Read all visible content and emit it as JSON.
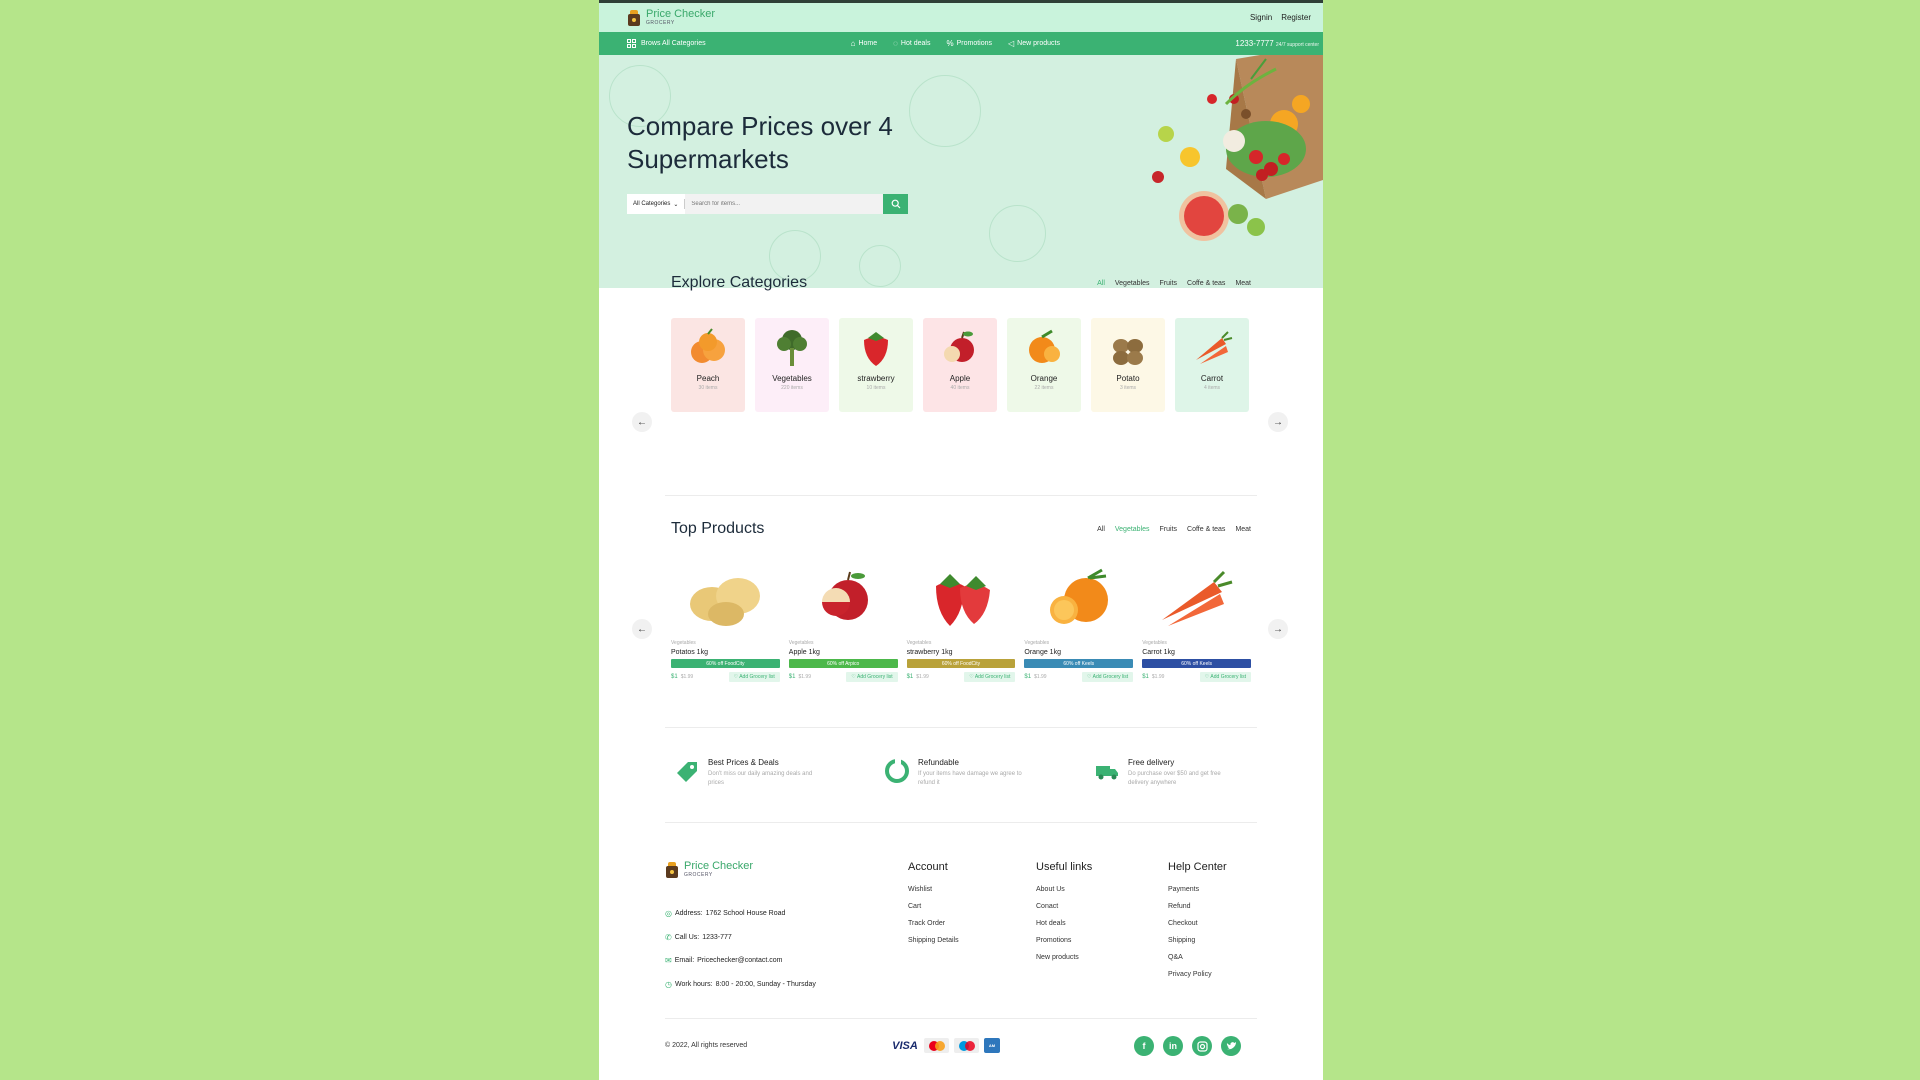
{
  "brand": {
    "name": "Price Checker",
    "sub": "GROCERY"
  },
  "auth": {
    "signin": "Signin",
    "register": "Register"
  },
  "nav": {
    "browse": "Brows All Categories",
    "links": [
      {
        "label": "Home",
        "icon": "home-icon"
      },
      {
        "label": "Hot deals",
        "icon": "flame-icon"
      },
      {
        "label": "Promotions",
        "icon": "percent-icon"
      },
      {
        "label": "New products",
        "icon": "megaphone-icon"
      }
    ],
    "phone": "1233-7777",
    "support": "24/7 support center"
  },
  "hero": {
    "title": "Compare Prices over 4 Supermarkets",
    "search_category": "All Categories",
    "search_placeholder": "Search for items..."
  },
  "categories": {
    "title": "Explore Categories",
    "filters": [
      "All",
      "Vegetables",
      "Fruits",
      "Coffe & teas",
      "Meat"
    ],
    "active_filter": "All",
    "items": [
      {
        "name": "Peach",
        "count": "30 items",
        "bg": "#fbe5e3"
      },
      {
        "name": "Vegetables",
        "count": "220 items",
        "bg": "#fdeef8"
      },
      {
        "name": "strawberry",
        "count": "10 items",
        "bg": "#eef9e8"
      },
      {
        "name": "Apple",
        "count": "40 items",
        "bg": "#fde4e6"
      },
      {
        "name": "Orange",
        "count": "22 items",
        "bg": "#eef9e8"
      },
      {
        "name": "Potato",
        "count": "3 items",
        "bg": "#fdf8e6"
      },
      {
        "name": "Carrot",
        "count": "4 items",
        "bg": "#def5e8"
      }
    ]
  },
  "products": {
    "title": "Top Products",
    "filters": [
      "All",
      "Vegetables",
      "Fruits",
      "Coffe & teas",
      "Meat"
    ],
    "active_filter": "Vegetables",
    "items": [
      {
        "category": "Vegetables",
        "name": "Potatos 1kg",
        "badge": "60% off FoodCity",
        "badge_color": "#3bb273",
        "price": "$1",
        "old": "$1.99",
        "add": "Add Grocery list"
      },
      {
        "category": "Vegetables",
        "name": "Apple 1kg",
        "badge": "60% off Arpico",
        "badge_color": "#4cb84a",
        "price": "$1",
        "old": "$1.99",
        "add": "Add Grocery list"
      },
      {
        "category": "Vegetables",
        "name": "strawberry 1kg",
        "badge": "60% off FoodCity",
        "badge_color": "#b9a23a",
        "price": "$1",
        "old": "$1.99",
        "add": "Add Grocery list"
      },
      {
        "category": "Vegetables",
        "name": "Orange 1kg",
        "badge": "60% off Keels",
        "badge_color": "#3a8bb5",
        "price": "$1",
        "old": "$1.99",
        "add": "Add Grocery list"
      },
      {
        "category": "Vegetables",
        "name": "Carrot 1kg",
        "badge": "60% off Keels",
        "badge_color": "#2d4fa3",
        "price": "$1",
        "old": "$1.99",
        "add": "Add Grocery list"
      }
    ]
  },
  "features": [
    {
      "title": "Best Prices & Deals",
      "desc": "Don't miss our daily amazing deals and prices"
    },
    {
      "title": "Refundable",
      "desc": "If your items have damage we agree to refund it"
    },
    {
      "title": "Free delivery",
      "desc": "Do purchase over $50 and get free delivery anywhere"
    }
  ],
  "contact": {
    "address_label": "Address:",
    "address": "1762 School House Road",
    "call_label": "Call Us:",
    "call": "1233-777",
    "email_label": "Email:",
    "email": "Pricechecker@contact.com",
    "hours_label": "Work hours:",
    "hours": "8:00 - 20:00, Sunday - Thursday"
  },
  "footer": {
    "account": {
      "title": "Account",
      "links": [
        "Wishlist",
        "Cart",
        "Track Order",
        "Shipping Details"
      ]
    },
    "useful": {
      "title": "Useful links",
      "links": [
        "About Us",
        "Conact",
        "Hot deals",
        "Promotions",
        "New products"
      ]
    },
    "help": {
      "title": "Help Center",
      "links": [
        "Payments",
        "Refund",
        "Checkout",
        "Shipping",
        "Q&A",
        "Privacy Policy"
      ]
    },
    "copyright": "© 2022, All rights reserved",
    "payments": [
      "VISA",
      "mastercard",
      "maestro",
      "amex"
    ],
    "social": [
      "f",
      "in",
      "ig",
      "tw"
    ]
  },
  "colors": {
    "accent": "#3bb273",
    "topbar": "#c9f3dc",
    "hero": "#d3f0e0",
    "outer": "#b5e58a"
  }
}
